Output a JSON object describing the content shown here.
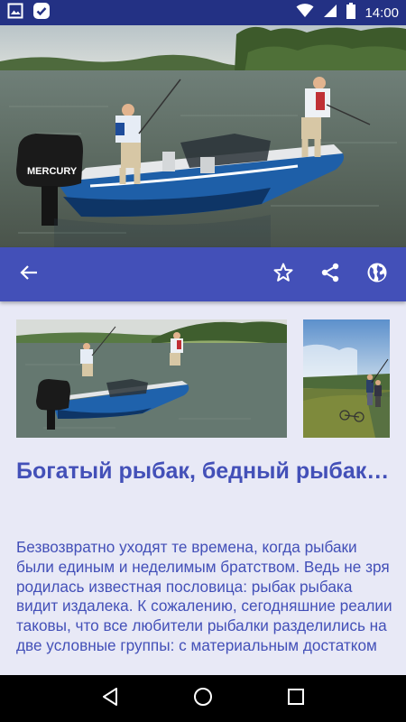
{
  "status_bar": {
    "time": "14:00",
    "icons": [
      "image-icon",
      "check-badge-icon",
      "wifi-icon",
      "signal-icon",
      "battery-icon"
    ]
  },
  "hero": {
    "boat_brand": "MERCURY"
  },
  "toolbar": {
    "icons": [
      "back-arrow-icon",
      "star-icon",
      "share-icon",
      "globe-icon"
    ],
    "color": "#4350b8"
  },
  "article": {
    "title": "Богатый рыбак, бедный рыбак…",
    "body": "Безвозвратно уходят те времена, когда рыбаки были единым и неделимым братством. Ведь не зря родилась известная пословица: рыбак рыбака видит издалека. К сожалению, сегодняшние реалии таковы, что все любители рыбалки разделились на две условные группы: с материальным достатком"
  },
  "gallery": {
    "items": [
      "boat-photo",
      "shore-fishing-photo"
    ]
  },
  "nav_bar": {
    "icons": [
      "back-triangle-icon",
      "home-circle-icon",
      "recents-square-icon"
    ]
  },
  "colors": {
    "status_bar": "#233184",
    "accent": "#4350b8",
    "background": "#e8e9f6"
  }
}
